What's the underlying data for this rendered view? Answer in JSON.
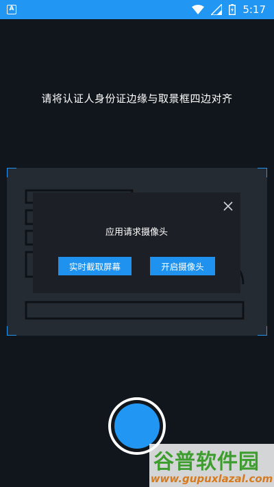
{
  "status_bar": {
    "app_badge": "A",
    "time": "5:17",
    "icons": [
      "wifi-icon",
      "signal-icon",
      "battery-charging-icon"
    ]
  },
  "instruction": "请将认证人身份证边缘与取景框四边对齐",
  "dialog": {
    "message": "应用请求摄像头",
    "button_screen": "实时截取屏幕",
    "button_camera": "开启摄像头",
    "close_icon": "close-icon"
  },
  "watermark": {
    "title": "谷普软件园",
    "url": "www.gupuxlazal.com"
  },
  "colors": {
    "accent": "#2196f3",
    "background": "#11161c",
    "frame": "#252b33",
    "dialog": "#1c2026"
  }
}
